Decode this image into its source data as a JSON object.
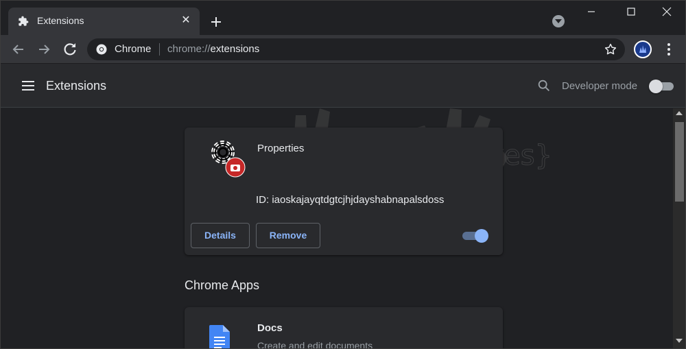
{
  "tab": {
    "title": "Extensions",
    "icon": "puzzle-icon",
    "close_glyph": "✕"
  },
  "omnibox": {
    "origin": "Chrome",
    "scheme": "chrome://",
    "host": "extensions"
  },
  "header": {
    "title": "Extensions",
    "developer_mode_label": "Developer mode",
    "developer_mode_on": false
  },
  "extension": {
    "name": "Properties",
    "id_text": "ID: iaoskajayqtdgtcjhjdayshabnapalsdoss",
    "details_label": "Details",
    "remove_label": "Remove",
    "enabled": true
  },
  "watermark": {
    "text": "{malwarefixes}"
  },
  "apps_section": {
    "title": "Chrome Apps",
    "apps": [
      {
        "name": "Docs",
        "description": "Create and edit documents"
      }
    ]
  },
  "colors": {
    "accent": "#8ab4f8",
    "background": "#202124",
    "card": "#292a2d",
    "toolbar": "#35363a"
  }
}
